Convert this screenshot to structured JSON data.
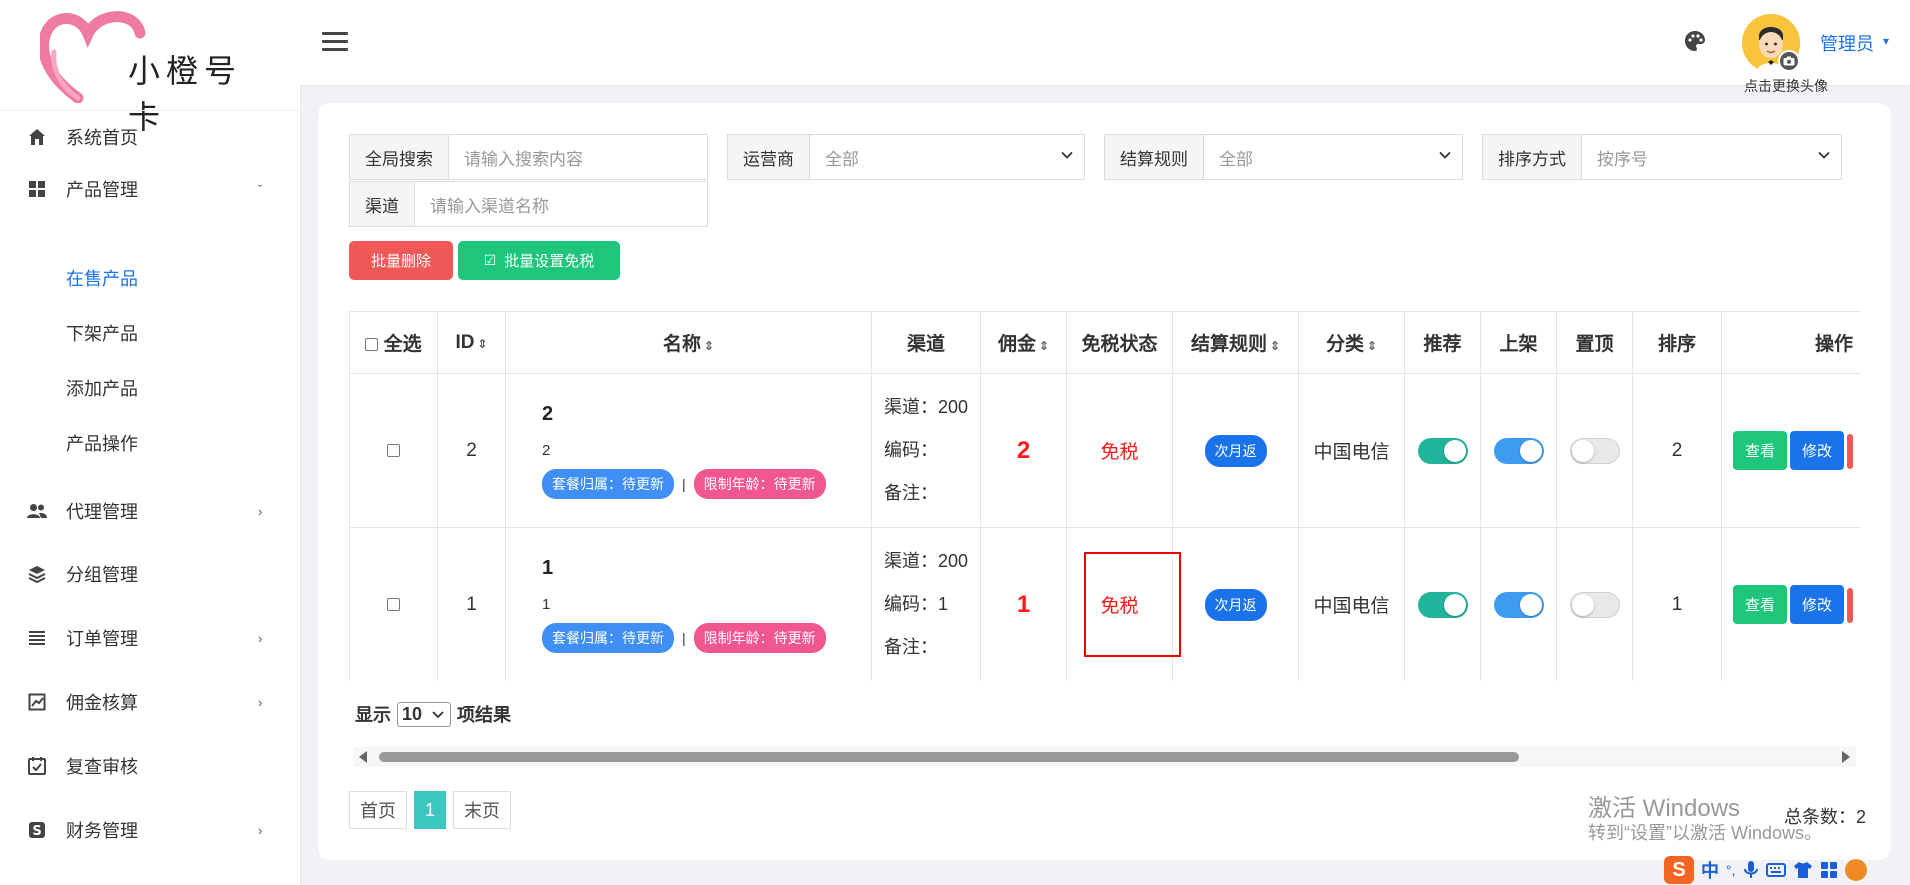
{
  "brand": {
    "logo_text": "小橙号卡",
    "accent_color": "#1a73e8",
    "logo_heart_color": "#ef7aa4"
  },
  "sidebar": {
    "items": [
      {
        "label": "系统首页",
        "icon": "home-icon"
      },
      {
        "label": "产品管理",
        "icon": "grid-icon",
        "expanded": true,
        "children": [
          "在售产品",
          "下架产品",
          "添加产品",
          "产品操作"
        ],
        "active_child": "在售产品"
      },
      {
        "label": "代理管理",
        "icon": "users-icon"
      },
      {
        "label": "分组管理",
        "icon": "layers-icon"
      },
      {
        "label": "订单管理",
        "icon": "list-icon"
      },
      {
        "label": "佣金核算",
        "icon": "chart-icon"
      },
      {
        "label": "复查审核",
        "icon": "calendar-check-icon"
      },
      {
        "label": "财务管理",
        "icon": "dollar-icon"
      }
    ],
    "expand_down_glyph": "ˇ",
    "collapsed_glyph": "›"
  },
  "header": {
    "user_name": "管理员",
    "avatar_hint": "点击更换头像",
    "caret": "▾"
  },
  "filters": {
    "global_search": {
      "label": "全局搜索",
      "placeholder": "请输入搜索内容"
    },
    "operator": {
      "label": "运营商",
      "value": "全部"
    },
    "settle_rule": {
      "label": "结算规则",
      "value": "全部"
    },
    "sort_by": {
      "label": "排序方式",
      "value": "按序号"
    },
    "channel": {
      "label": "渠道",
      "placeholder": "请输入渠道名称"
    }
  },
  "actions": {
    "batch_delete": "批量删除",
    "batch_tax_free": "批量设置免税",
    "tax_free_icon": "☑"
  },
  "table": {
    "columns": [
      "全选",
      "ID",
      "名称",
      "渠道",
      "佣金",
      "免税状态",
      "结算规则",
      "分类",
      "推荐",
      "上架",
      "置顶",
      "排序",
      "操作"
    ],
    "sort_glyph": "⇕",
    "rows": [
      {
        "id": "2",
        "name": "2",
        "subtitle": "2",
        "tag_region": "套餐归属：待更新",
        "tag_age": "限制年龄：待更新",
        "separator": "|",
        "channel": "渠道：200",
        "code": "编码：",
        "remark": "备注：",
        "commission": "2",
        "tax_status": "免税",
        "settle_rule": "次月返",
        "category": "中国电信",
        "recommend": true,
        "listed": true,
        "pinned": false,
        "order": "2",
        "view": "查看",
        "edit": "修改"
      },
      {
        "id": "1",
        "name": "1",
        "subtitle": "1",
        "tag_region": "套餐归属：待更新",
        "tag_age": "限制年龄：待更新",
        "separator": "|",
        "channel": "渠道：200",
        "code": "编码：1",
        "remark": "备注：",
        "commission": "1",
        "tax_status": "免税",
        "settle_rule": "次月返",
        "category": "中国电信",
        "recommend": true,
        "listed": true,
        "pinned": false,
        "order": "1",
        "view": "查看",
        "edit": "修改"
      }
    ]
  },
  "length_menu": {
    "prefix": "显示",
    "value": "10",
    "suffix": "项结果"
  },
  "pagination": {
    "first": "首页",
    "current": "1",
    "last": "末页",
    "total": "总条数：2"
  },
  "os": {
    "watermark_title": "激活 Windows",
    "watermark_sub": "转到“设置”以激活 Windows。",
    "ime_lang": "中",
    "ime_punct": "°,"
  },
  "colors": {
    "green": "#1dc67a",
    "blue": "#1a73e8",
    "red": "#f05757",
    "teal_page": "#3cc8c0"
  }
}
